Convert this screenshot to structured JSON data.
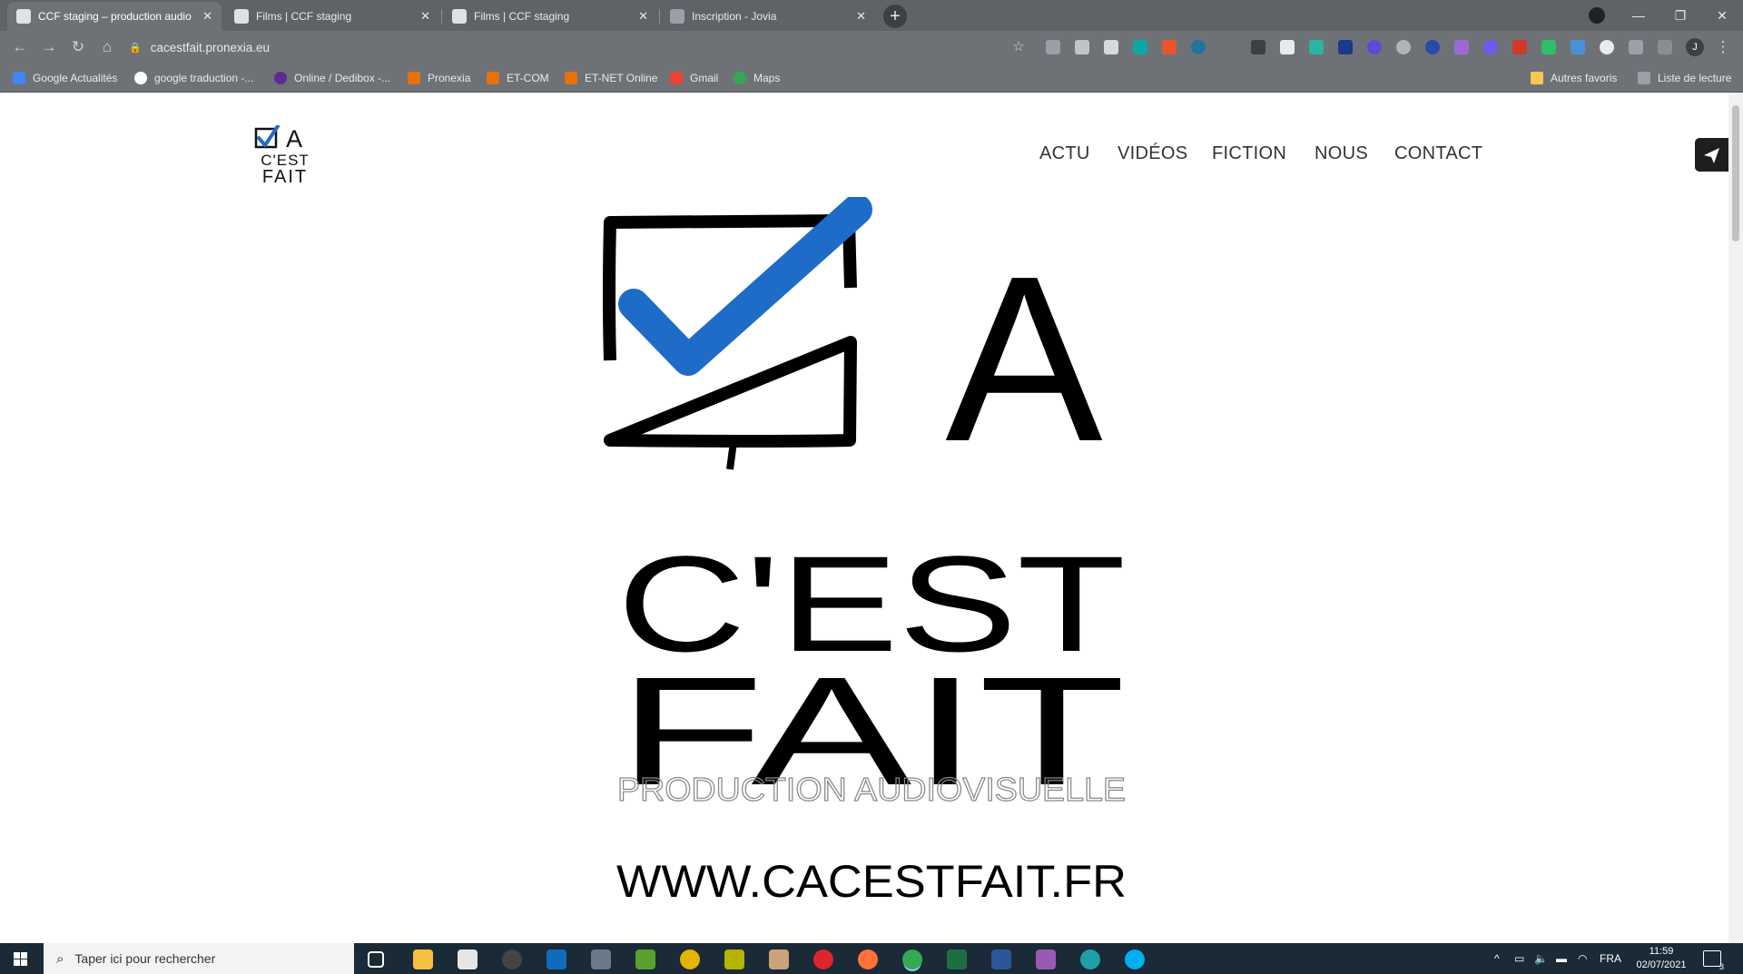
{
  "browser": {
    "tabs": [
      {
        "title": "CCF staging – production audio",
        "active": true
      },
      {
        "title": "Films | CCF staging",
        "active": false
      },
      {
        "title": "Films | CCF staging",
        "active": false
      },
      {
        "title": "Inscription - Jovia",
        "active": false
      }
    ],
    "new_tab_label": "+",
    "url": "cacestfait.pronexia.eu",
    "profile_initial": "J",
    "bookmarks": [
      {
        "label": "Google Actualités",
        "color": "#4285f4"
      },
      {
        "label": "google traduction -...",
        "color": "#ffffff"
      },
      {
        "label": "Online / Dedibox -...",
        "color": "#5b2d8e"
      },
      {
        "label": "Pronexia",
        "color": "#e8710a"
      },
      {
        "label": "ET-COM",
        "color": "#e8710a"
      },
      {
        "label": "ET-NET Online",
        "color": "#e8710a"
      },
      {
        "label": "Gmail",
        "color": "#ea4335"
      },
      {
        "label": "Maps",
        "color": "#34a853"
      }
    ],
    "other_bookmarks": "Autres favoris",
    "reading_list": "Liste de lecture"
  },
  "site": {
    "logo_small": {
      "line1": "A",
      "line2": "C'EST",
      "line3": "FAIT"
    },
    "nav": [
      "ACTU",
      "VIDÉOS",
      "FICTION",
      "NOUS",
      "CONTACT"
    ],
    "hero": {
      "line1": "A",
      "line2": "C'EST",
      "line3": "FAIT",
      "tagline": "PRODUCTION AUDIOVISUELLE",
      "website": "WWW.CACESTFAIT.FR"
    },
    "accent_color": "#1e6cc8"
  },
  "taskbar": {
    "search_placeholder": "Taper ici pour rechercher",
    "language": "FRA",
    "time": "11:59",
    "date": "02/07/2021",
    "notification_count": "3"
  }
}
